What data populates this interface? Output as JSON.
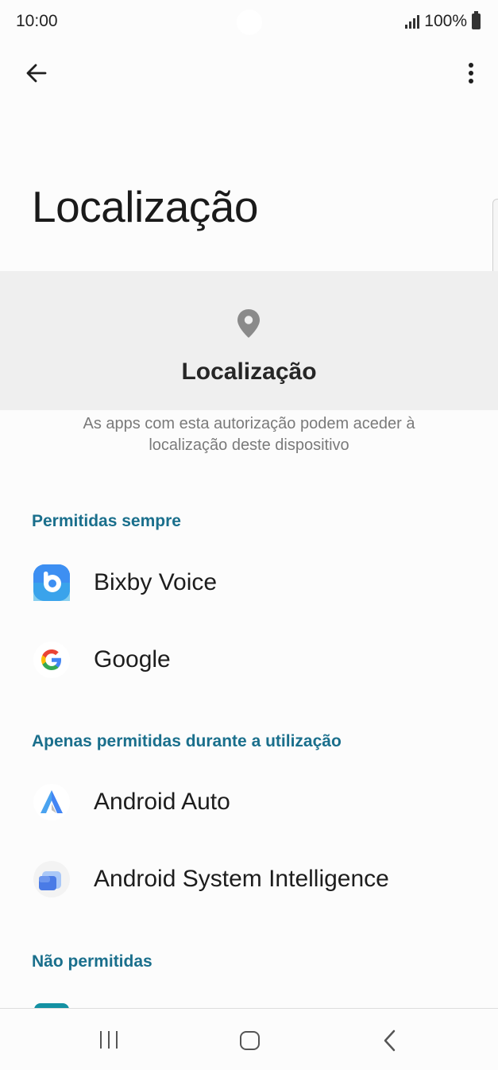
{
  "status_bar": {
    "time": "10:00",
    "battery": "100%"
  },
  "toolbar": {
    "back_icon": "arrow-left-icon",
    "more_icon": "more-vert-icon"
  },
  "page": {
    "title": "Localização"
  },
  "header_card": {
    "icon": "location-pin-icon",
    "title": "Localização"
  },
  "description": "As apps com esta autorização podem aceder à localização deste dispositivo",
  "sections": [
    {
      "header": "Permitidas sempre",
      "apps": [
        {
          "name": "Bixby Voice",
          "icon": "bixby-voice-icon"
        },
        {
          "name": "Google",
          "icon": "google-icon"
        }
      ]
    },
    {
      "header": "Apenas permitidas durante a utilização",
      "apps": [
        {
          "name": "Android Auto",
          "icon": "android-auto-icon"
        },
        {
          "name": "Android System Intelligence",
          "icon": "android-system-intelligence-icon"
        }
      ]
    },
    {
      "header": "Não permitidas",
      "apps": []
    }
  ],
  "nav_bar": {
    "recent_icon": "recent-apps-icon",
    "home_icon": "home-icon",
    "back_icon": "back-icon"
  },
  "colors": {
    "accent": "#1a6f8c",
    "background": "#fcfcfc",
    "card": "#efefef"
  }
}
